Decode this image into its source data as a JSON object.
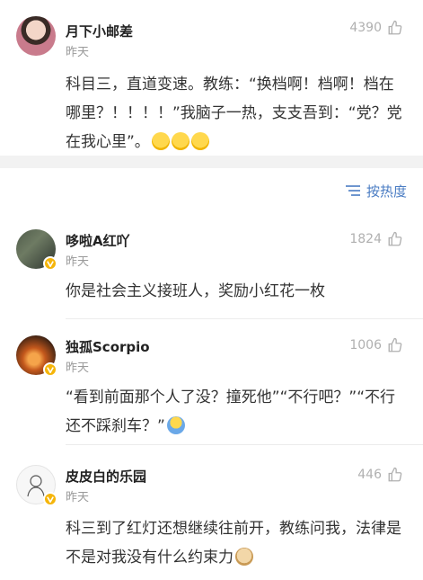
{
  "post": {
    "author": "月下小邮差",
    "time": "昨天",
    "likes": "4390",
    "content": "科目三，直道变速。教练：“换档啊！档啊！档在哪里？！！！！”我脑子一热，支支吾到：“党？党在我心里”。"
  },
  "sort": {
    "label": "按热度"
  },
  "comments": [
    {
      "author": "哆啦A红吖",
      "time": "昨天",
      "likes": "1824",
      "content": "你是社会主义接班人，奖励小红花一枚"
    },
    {
      "author": "独孤Scorpio",
      "time": "昨天",
      "likes": "1006",
      "content": "“看到前面那个人了没？撞死他”“不行吧？”“不行还不踩刹车？”"
    },
    {
      "author": "皮皮白的乐园",
      "time": "昨天",
      "likes": "446",
      "content": "科三到了红灯还想继续往前开，教练问我，法律是不是对我没有什么约束力"
    }
  ],
  "colors": {
    "link": "#4a7cc3",
    "badge": "#f5b50a",
    "separator": "#f2f2f2"
  }
}
